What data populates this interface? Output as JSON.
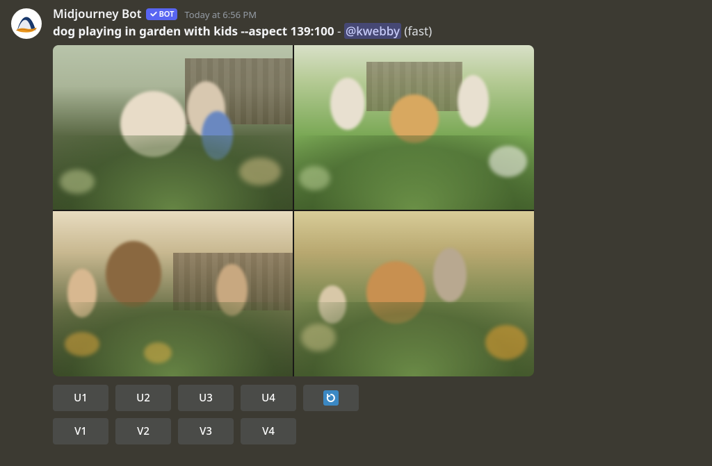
{
  "author": {
    "name": "Midjourney Bot",
    "botLabel": "BOT"
  },
  "timestamp": "Today at 6:56 PM",
  "prompt": {
    "text": "dog playing in garden with kids --aspect 139:100",
    "separator": " - ",
    "mention": "@kwebby",
    "mode": "(fast)"
  },
  "buttons": {
    "row1": [
      "U1",
      "U2",
      "U3",
      "U4"
    ],
    "row2": [
      "V1",
      "V2",
      "V3",
      "V4"
    ]
  }
}
